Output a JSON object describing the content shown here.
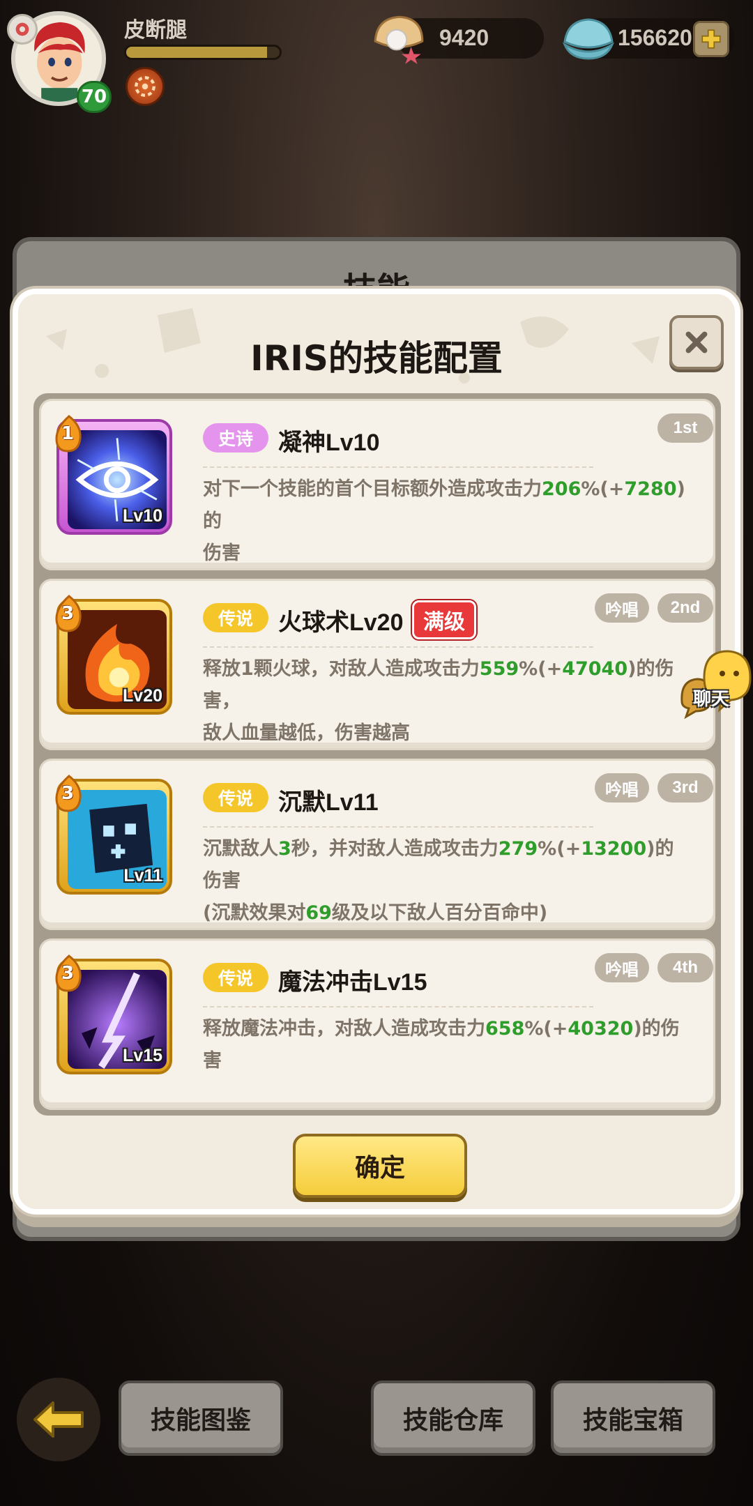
{
  "hud": {
    "player_name": "皮断腿",
    "level": "70",
    "pearl_value": "9420",
    "shell_value": "156620",
    "exp_fraction": 0.92
  },
  "background_panel": {
    "title": "技能"
  },
  "modal": {
    "title": "IRIS的技能配置",
    "confirm_label": "确定",
    "skills": [
      {
        "slot": "1",
        "rarity": "史诗",
        "name": "凝神Lv10",
        "icon_level": "Lv10",
        "order": "1st",
        "desc_line1": [
          "对下一个技能的首个目标额外造成攻击力",
          "206",
          "%(+",
          "7280",
          ")的"
        ],
        "desc_line2": "伤害"
      },
      {
        "slot": "3",
        "rarity": "传说",
        "name": "火球术Lv20",
        "icon_level": "Lv20",
        "max_badge": "满级",
        "chant": "吟唱",
        "order": "2nd",
        "desc_line1": [
          "释放1颗火球，对敌人造成攻击力",
          "559",
          "%(+",
          "47040",
          ")的伤害，"
        ],
        "desc_line2": "敌人血量越低，伤害越高"
      },
      {
        "slot": "3",
        "rarity": "传说",
        "name": "沉默Lv11",
        "icon_level": "Lv11",
        "chant": "吟唱",
        "order": "3rd",
        "desc_line1": [
          "沉默敌人",
          "3",
          "秒，并对敌人造成攻击力",
          "279",
          "%(+",
          "13200",
          ")的伤害"
        ],
        "desc_line2": [
          "(沉默效果对",
          "69",
          "级及以下敌人百分百命中)"
        ]
      },
      {
        "slot": "3",
        "rarity": "传说",
        "name": "魔法冲击Lv15",
        "icon_level": "Lv15",
        "chant": "吟唱",
        "order": "4th",
        "desc_line1": [
          "释放魔法冲击，对敌人造成攻击力",
          "658",
          "%(+",
          "40320",
          ")的伤害"
        ]
      }
    ]
  },
  "chat": {
    "label": "聊天"
  },
  "bottom_nav": {
    "atlas": "技能图鉴",
    "storage": "技能仓库",
    "chest": "技能宝箱"
  },
  "colors": {
    "highlight_green": "#2f9d2c",
    "epic_tag": "#e494ec",
    "legend_tag": "#f5c62a",
    "max_badge": "#e8383a",
    "confirm_button": "#f5cd3b"
  }
}
